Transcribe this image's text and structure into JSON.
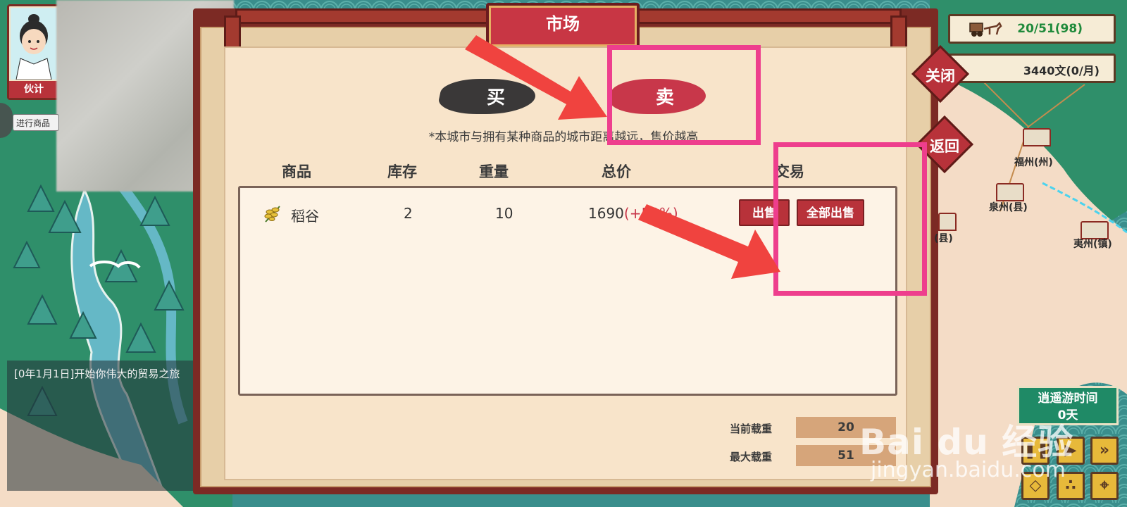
{
  "companion": {
    "label": "伙计"
  },
  "left_tab": {
    "label": "进行商品"
  },
  "log": {
    "message": "[0年1月1日]开始你伟大的贸易之旅"
  },
  "market": {
    "title": "市场",
    "tabs": {
      "buy": "买",
      "sell": "卖",
      "active": "sell"
    },
    "hint": "*本城市与拥有某种商品的城市距离越远，售价越高",
    "columns": [
      "商品",
      "库存",
      "重量",
      "总价",
      "交易"
    ],
    "rows": [
      {
        "item": "稻谷",
        "item_icon": "rice-grain-icon",
        "stock": "2",
        "weight": "10",
        "total_price": "1690",
        "price_change": "(+59%)",
        "sell_label": "出售",
        "sell_all_label": "全部出售"
      }
    ],
    "load": {
      "current_label": "当前载重",
      "current_value": "20",
      "max_label": "最大载重",
      "max_value": "51"
    }
  },
  "hud": {
    "cargo": "20/51(98)",
    "cargo_icon": "horse-cart-icon",
    "money": "3440文(0/月)",
    "close_label": "关闭",
    "back_label": "返回"
  },
  "map": {
    "cities": [
      "福州(州)",
      "泉州(县)",
      "夷州(镇)",
      "(县)"
    ]
  },
  "controls": {
    "travel_title": "逍遥游时间",
    "travel_days": "0天",
    "buttons": [
      "pause-icon",
      "play-icon",
      "fast-forward-icon",
      "map-icon",
      "footprints-icon",
      "location-pin-icon"
    ]
  },
  "watermark": {
    "logo": "Bai du 经验",
    "url": "jingyan.baidu.com"
  },
  "colors": {
    "accent_red": "#b8323a",
    "annotation_pink": "#ee3e8d",
    "arrow_red": "#f0433f",
    "cargo_green": "#1f8a3b",
    "price_change_red": "#c8374a"
  }
}
